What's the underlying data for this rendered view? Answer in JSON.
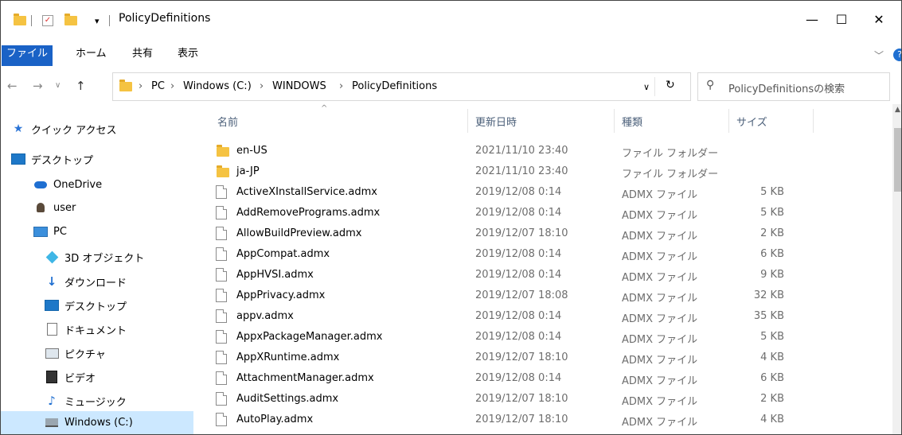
{
  "window": {
    "title": "PolicyDefinitions",
    "minimize": "—",
    "maximize": "☐",
    "close": "✕"
  },
  "ribbon": {
    "tabs": [
      "ファイル",
      "ホーム",
      "共有",
      "表示"
    ]
  },
  "address": {
    "crumbs": [
      "PC",
      "Windows (C:)",
      "WINDOWS",
      "PolicyDefinitions"
    ],
    "search_placeholder": "PolicyDefinitionsの検索"
  },
  "nav": {
    "items": [
      {
        "label": "クイック アクセス",
        "icon": "star-icon"
      },
      {
        "label": "デスクトップ",
        "icon": "desktop-icon"
      },
      {
        "label": "OneDrive",
        "icon": "cloud-icon"
      },
      {
        "label": "user",
        "icon": "user-icon"
      },
      {
        "label": "PC",
        "icon": "pc-icon"
      },
      {
        "label": "3D オブジェクト",
        "icon": "cube-icon"
      },
      {
        "label": "ダウンロード",
        "icon": "download-icon"
      },
      {
        "label": "デスクトップ",
        "icon": "desktop-icon"
      },
      {
        "label": "ドキュメント",
        "icon": "document-icon"
      },
      {
        "label": "ピクチャ",
        "icon": "picture-icon"
      },
      {
        "label": "ビデオ",
        "icon": "video-icon"
      },
      {
        "label": "ミュージック",
        "icon": "music-icon"
      },
      {
        "label": "Windows (C:)",
        "icon": "drive-icon"
      }
    ],
    "selected_index": 12
  },
  "columns": {
    "name": "名前",
    "date": "更新日時",
    "type": "種類",
    "size": "サイズ"
  },
  "files": [
    {
      "name": "en-US",
      "date": "2021/11/10 23:40",
      "type": "ファイル フォルダー",
      "size": "",
      "kind": "folder"
    },
    {
      "name": "ja-JP",
      "date": "2021/11/10 23:40",
      "type": "ファイル フォルダー",
      "size": "",
      "kind": "folder"
    },
    {
      "name": "ActiveXInstallService.admx",
      "date": "2019/12/08 0:14",
      "type": "ADMX ファイル",
      "size": "5 KB",
      "kind": "file"
    },
    {
      "name": "AddRemovePrograms.admx",
      "date": "2019/12/08 0:14",
      "type": "ADMX ファイル",
      "size": "5 KB",
      "kind": "file"
    },
    {
      "name": "AllowBuildPreview.admx",
      "date": "2019/12/07 18:10",
      "type": "ADMX ファイル",
      "size": "2 KB",
      "kind": "file"
    },
    {
      "name": "AppCompat.admx",
      "date": "2019/12/08 0:14",
      "type": "ADMX ファイル",
      "size": "6 KB",
      "kind": "file"
    },
    {
      "name": "AppHVSI.admx",
      "date": "2019/12/08 0:14",
      "type": "ADMX ファイル",
      "size": "9 KB",
      "kind": "file"
    },
    {
      "name": "AppPrivacy.admx",
      "date": "2019/12/07 18:08",
      "type": "ADMX ファイル",
      "size": "32 KB",
      "kind": "file"
    },
    {
      "name": "appv.admx",
      "date": "2019/12/08 0:14",
      "type": "ADMX ファイル",
      "size": "35 KB",
      "kind": "file"
    },
    {
      "name": "AppxPackageManager.admx",
      "date": "2019/12/08 0:14",
      "type": "ADMX ファイル",
      "size": "5 KB",
      "kind": "file"
    },
    {
      "name": "AppXRuntime.admx",
      "date": "2019/12/07 18:10",
      "type": "ADMX ファイル",
      "size": "4 KB",
      "kind": "file"
    },
    {
      "name": "AttachmentManager.admx",
      "date": "2019/12/08 0:14",
      "type": "ADMX ファイル",
      "size": "6 KB",
      "kind": "file"
    },
    {
      "name": "AuditSettings.admx",
      "date": "2019/12/07 18:10",
      "type": "ADMX ファイル",
      "size": "2 KB",
      "kind": "file"
    },
    {
      "name": "AutoPlay.admx",
      "date": "2019/12/07 18:10",
      "type": "ADMX ファイル",
      "size": "4 KB",
      "kind": "file"
    }
  ],
  "colors": {
    "accent": "#1a62c6",
    "selected": "#cce8ff",
    "folder": "#f5c342"
  }
}
